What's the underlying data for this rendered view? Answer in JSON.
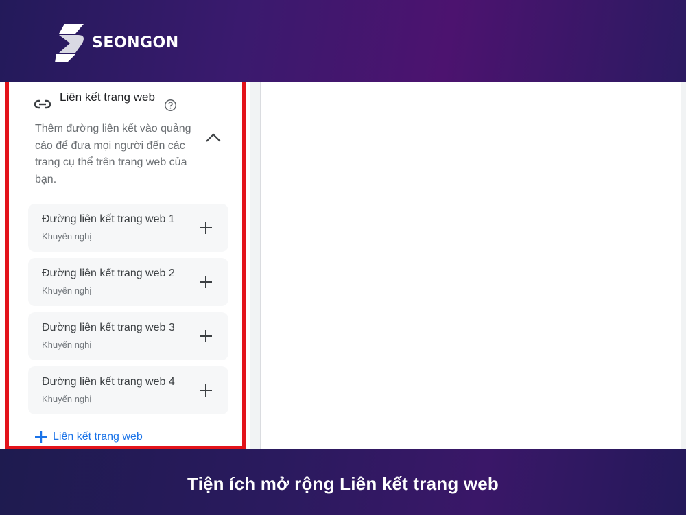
{
  "brand": {
    "name": "SEONGON",
    "logo_icon": "seongon-ribbon-logo"
  },
  "panel": {
    "title": "Liên kết trang web",
    "title_icon": "link-icon",
    "help_icon": "help-circle-icon",
    "description": "Thêm đường liên kết vào quảng cáo để đưa mọi người đến các trang cụ thể trên trang web của bạn.",
    "collapse_icon": "chevron-up-icon",
    "links": [
      {
        "title": "Đường liên kết trang web 1",
        "subtitle": "Khuyến nghị"
      },
      {
        "title": "Đường liên kết trang web 2",
        "subtitle": "Khuyến nghị"
      },
      {
        "title": "Đường liên kết trang web 3",
        "subtitle": "Khuyến nghị"
      },
      {
        "title": "Đường liên kết trang web 4",
        "subtitle": "Khuyến nghị"
      }
    ],
    "add_label": "Liên kết trang web"
  },
  "caption": "Tiện ích mở rộng Liên kết trang web",
  "colors": {
    "highlight_border": "#e3131b",
    "accent_blue": "#1a73e8",
    "header_purple": "#3a1a6e"
  }
}
